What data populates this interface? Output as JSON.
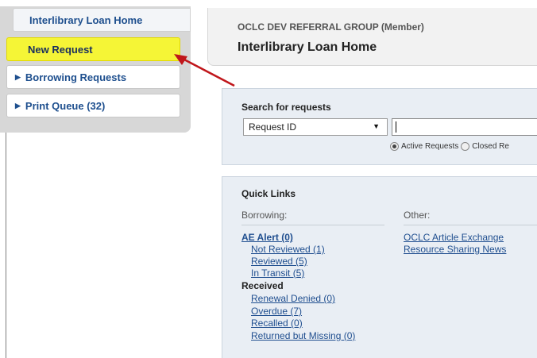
{
  "sidebar": {
    "items": [
      {
        "label": "Interlibrary Loan Home"
      },
      {
        "label": "New Request"
      },
      {
        "label": "Borrowing Requests"
      },
      {
        "label": "Print Queue (32)"
      }
    ]
  },
  "header": {
    "org": "OCLC DEV REFERRAL GROUP (Member)",
    "title": "Interlibrary Loan Home"
  },
  "search": {
    "heading": "Search for requests",
    "select_value": "Request ID",
    "input_value": "",
    "radio_active": "Active Requests",
    "radio_closed": "Closed Re"
  },
  "quick_links": {
    "heading": "Quick Links",
    "borrowing_heading": "Borrowing:",
    "other_heading": "Other:",
    "ae_alert": "AE Alert (0)",
    "not_reviewed": "Not Reviewed (1)",
    "reviewed": "Reviewed (5)",
    "in_transit": "In Transit (5)",
    "received": "Received",
    "renewal_denied": "Renewal Denied (0)",
    "overdue": "Overdue (7)",
    "recalled": "Recalled (0)",
    "returned_missing": "Returned but Missing (0)",
    "article_exchange": "OCLC Article Exchange",
    "sharing_news": "Resource Sharing News"
  },
  "colors": {
    "highlight": "#f5f536",
    "link": "#1f4e8f",
    "arrow": "#c0161b",
    "panel": "#e9eef4"
  },
  "icons": {
    "expand": "triangle-right-icon",
    "dropdown": "triangle-down-icon"
  }
}
